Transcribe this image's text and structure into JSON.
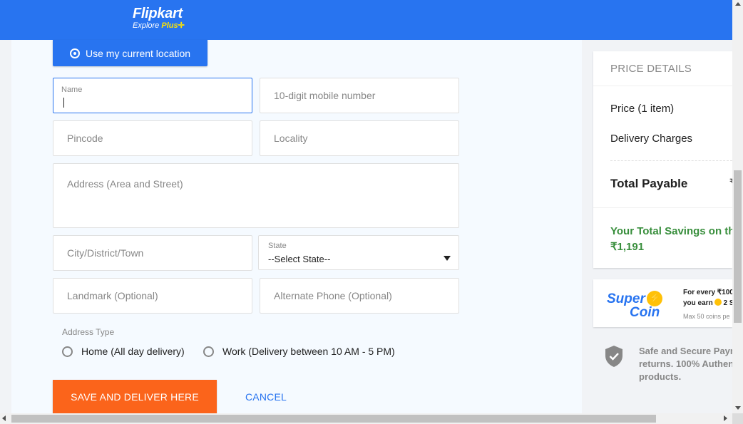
{
  "brand": {
    "name": "Flipkart",
    "tagline_prefix": "Explore ",
    "tagline_plus": "Plus",
    "colors": {
      "primary": "#2874f0",
      "accent": "#fb641b",
      "plus": "#ffe500"
    }
  },
  "form": {
    "location_button": "Use my current location",
    "name": {
      "label": "Name",
      "value": ""
    },
    "mobile": {
      "placeholder": "10-digit mobile number"
    },
    "pincode": {
      "placeholder": "Pincode"
    },
    "locality": {
      "placeholder": "Locality"
    },
    "address": {
      "placeholder": "Address (Area and Street)"
    },
    "city": {
      "placeholder": "City/District/Town"
    },
    "state": {
      "label": "State",
      "selected": "--Select State--"
    },
    "landmark": {
      "placeholder": "Landmark (Optional)"
    },
    "alt_phone": {
      "placeholder": "Alternate Phone (Optional)"
    },
    "address_type": {
      "label": "Address Type",
      "options": [
        "Home (All day delivery)",
        "Work (Delivery between 10 AM - 5 PM)"
      ]
    },
    "save_button": "SAVE AND DELIVER HERE",
    "cancel_button": "CANCEL"
  },
  "price_details": {
    "title": "PRICE DETAILS",
    "price_label": "Price (1 item)",
    "delivery_label": "Delivery Charges",
    "total_label": "Total Payable",
    "savings_label": "Your Total Savings on th",
    "savings_value": "₹1,191",
    "savings_color": "#388e3c"
  },
  "supercoin": {
    "logo_line1": "Super",
    "logo_line2": "Coin",
    "line1": "For every ₹100",
    "line2_prefix": "you earn",
    "line2_value": "2 S",
    "line3": "Max 50 coins pe"
  },
  "secure": {
    "line1": "Safe and Secure Paym",
    "line2": "returns. 100% Authen",
    "line3": "products."
  },
  "icons": {
    "location": "target-icon",
    "dropdown": "chevron-down-icon",
    "shield": "shield-check-icon",
    "coin": "supercoin-icon"
  }
}
